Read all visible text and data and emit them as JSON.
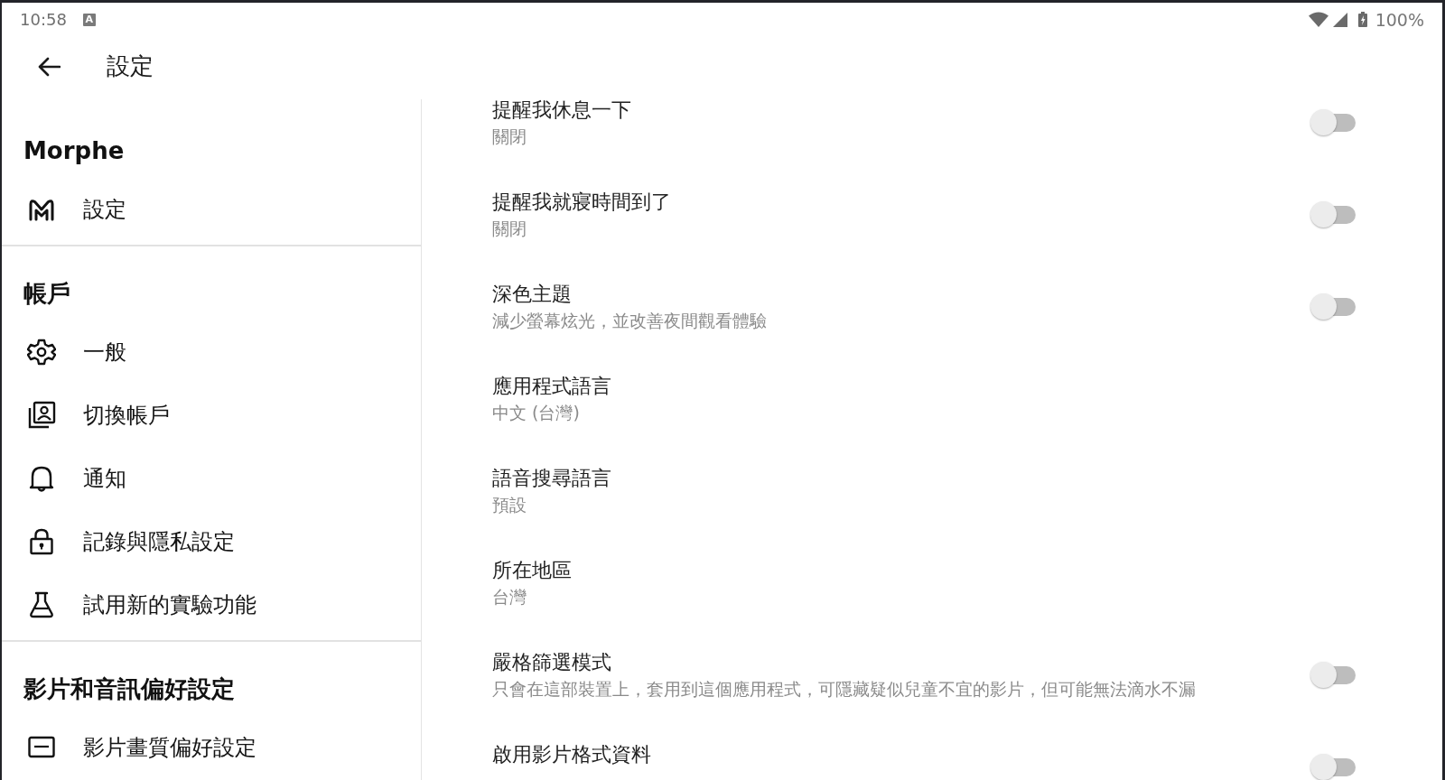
{
  "status_bar": {
    "time": "10:58",
    "indicator": "A",
    "battery": "100%"
  },
  "app_bar": {
    "title": "設定"
  },
  "sidebar": {
    "sections": [
      {
        "heading": "Morphe",
        "items": [
          {
            "label": "設定"
          }
        ]
      },
      {
        "heading": "帳戶",
        "items": [
          {
            "label": "一般"
          },
          {
            "label": "切換帳戶"
          },
          {
            "label": "通知"
          },
          {
            "label": "記錄與隱私設定"
          },
          {
            "label": "試用新的實驗功能"
          }
        ]
      },
      {
        "heading": "影片和音訊偏好設定",
        "items": [
          {
            "label": "影片畫質偏好設定"
          }
        ]
      }
    ]
  },
  "settings": [
    {
      "kind": "toggle",
      "title": "提醒我休息一下",
      "subtitle": "關閉",
      "on": false
    },
    {
      "kind": "toggle",
      "title": "提醒我就寢時間到了",
      "subtitle": "關閉",
      "on": false
    },
    {
      "kind": "toggle",
      "title": "深色主題",
      "subtitle": "減少螢幕炫光，並改善夜間觀看體驗",
      "on": false
    },
    {
      "kind": "value",
      "title": "應用程式語言",
      "subtitle": "中文 (台灣)"
    },
    {
      "kind": "value",
      "title": "語音搜尋語言",
      "subtitle": "預設"
    },
    {
      "kind": "value",
      "title": "所在地區",
      "subtitle": "台灣"
    },
    {
      "kind": "toggle",
      "title": "嚴格篩選模式",
      "subtitle": "只會在這部裝置上，套用到這個應用程式，可隱藏疑似兒童不宜的影片，但可能無法滴水不漏",
      "on": false
    },
    {
      "kind": "toggle",
      "title": "啟用影片格式資料",
      "on": false
    }
  ]
}
